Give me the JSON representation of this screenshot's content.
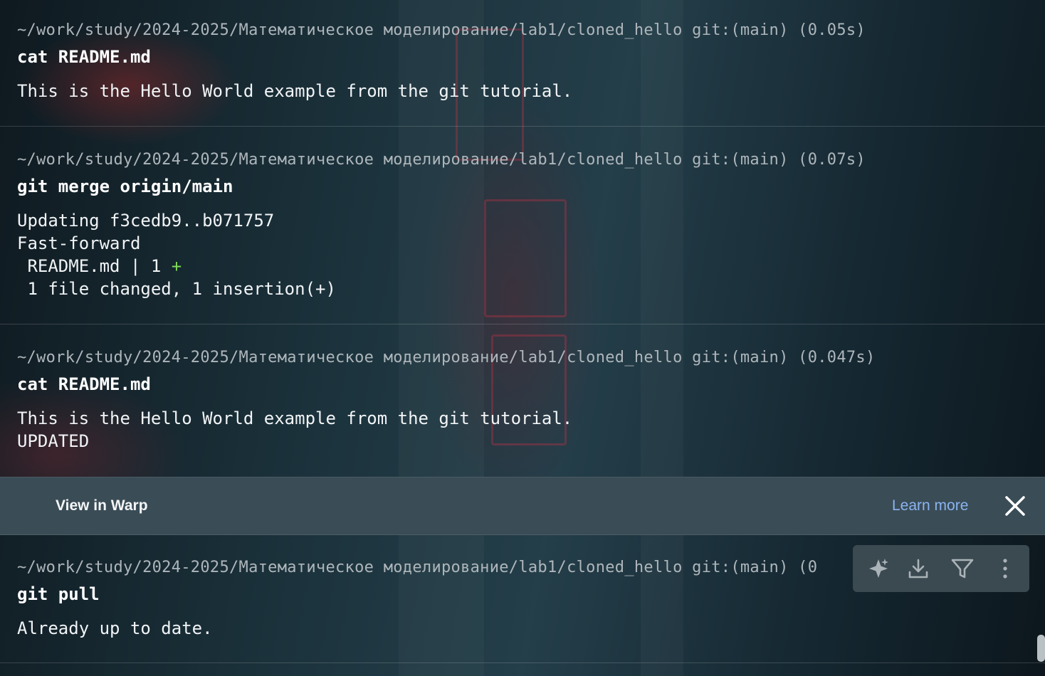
{
  "blocks": [
    {
      "prompt": "~/work/study/2024-2025/Математическое моделирование/lab1/cloned_hello git:(main) (0.05s)",
      "command": "cat README.md",
      "output": [
        "This is the Hello World example from the git tutorial."
      ]
    },
    {
      "prompt": "~/work/study/2024-2025/Математическое моделирование/lab1/cloned_hello git:(main) (0.07s)",
      "command": "git merge origin/main",
      "output": [
        "Updating f3cedb9..b071757",
        "Fast-forward",
        " README.md | 1 ",
        " 1 file changed, 1 insertion(+)"
      ],
      "diff_plus": "+"
    },
    {
      "prompt": "~/work/study/2024-2025/Математическое моделирование/lab1/cloned_hello git:(main) (0.047s)",
      "command": "cat README.md",
      "output": [
        "This is the Hello World example from the git tutorial.",
        "UPDATED"
      ]
    },
    {
      "prompt": "~/work/study/2024-2025/Математическое моделирование/lab1/cloned_hello git:(main) (0",
      "command": "git pull",
      "output": [
        "Already up to date."
      ]
    }
  ],
  "banner": {
    "title": "View in Warp",
    "link": "Learn more",
    "close_icon": "close-icon"
  },
  "toolbar": {
    "icons": [
      "sparkle-icon",
      "download-icon",
      "filter-icon",
      "more-vertical-icon"
    ]
  },
  "colors": {
    "prompt": "#aeb6bb",
    "diff_plus": "#7ed957",
    "link": "#8ab4f0",
    "banner_bg": "#3a4c56"
  }
}
